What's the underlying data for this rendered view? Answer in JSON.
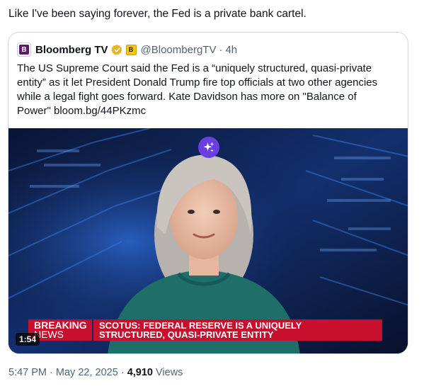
{
  "tweet": {
    "text": "Like I've been saying forever, the Fed is a private bank cartel."
  },
  "quote": {
    "avatar_letter": "B",
    "display_name": "Bloomberg TV",
    "org_badge": "B",
    "handle": "@BloombergTV",
    "separator": "·",
    "time_ago": "4h",
    "body_lines": [
      "The US Supreme Court said the Fed is a “uniquely structured, quasi-private",
      "entity” as it let President Donald Trump fire top officials at two other agencies",
      "while a legal fight goes forward. Kate Davidson has more on \"Balance of",
      "Power\" bloom.bg/44PKzmc"
    ],
    "video": {
      "breaking_line1": "BREAKING",
      "breaking_line2": "NEWS",
      "headline_line1": "SCOTUS: FEDERAL RESERVE IS A UNIQUELY",
      "headline_line2": "STRUCTURED, QUASI-PRIVATE ENTITY",
      "duration": "1:54"
    }
  },
  "meta": {
    "time": "5:47 PM",
    "separator1": "·",
    "date": "May 22, 2025",
    "separator2": "·",
    "views_count": "4,910",
    "views_label": "Views"
  },
  "colors": {
    "breaking_red": "#c8102e",
    "sparkle_purple": "#6a3fe0",
    "verified_gold": "#e8b424"
  }
}
